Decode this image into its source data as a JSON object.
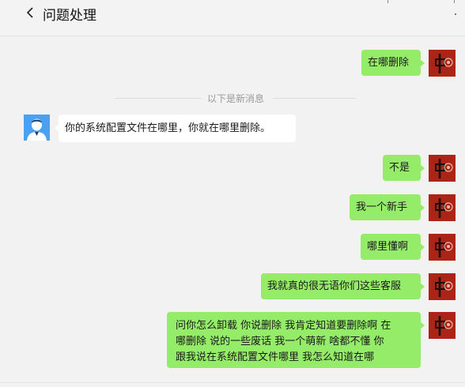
{
  "header": {
    "back_icon": "chevron-left-icon",
    "title": "问题处理"
  },
  "divider": {
    "label": "以下是新消息"
  },
  "messages": [
    {
      "sender": "me",
      "text": "在哪删除"
    },
    {
      "sender": "other",
      "text": "你的系统配置文件在哪里，你就在哪里删除。"
    },
    {
      "sender": "me",
      "text": "不是"
    },
    {
      "sender": "me",
      "text": "我一个新手"
    },
    {
      "sender": "me",
      "text": "哪里懂啊"
    },
    {
      "sender": "me",
      "text": "我就真的很无语你们这些客服"
    },
    {
      "sender": "me",
      "lines": [
        "问你怎么卸载  你说删除 我肯定知道要删除啊  在",
        "哪删除 说的一些废话   我一个萌新  啥都不懂 你",
        "跟我说在系统配置文件哪里  我怎么知道在哪"
      ]
    }
  ],
  "colors": {
    "my_bubble": "#95ec69",
    "other_bubble": "#ffffff",
    "background": "#f2f2f2",
    "user_avatar": "#ab2415",
    "agent_avatar": "#4aa0f2"
  }
}
